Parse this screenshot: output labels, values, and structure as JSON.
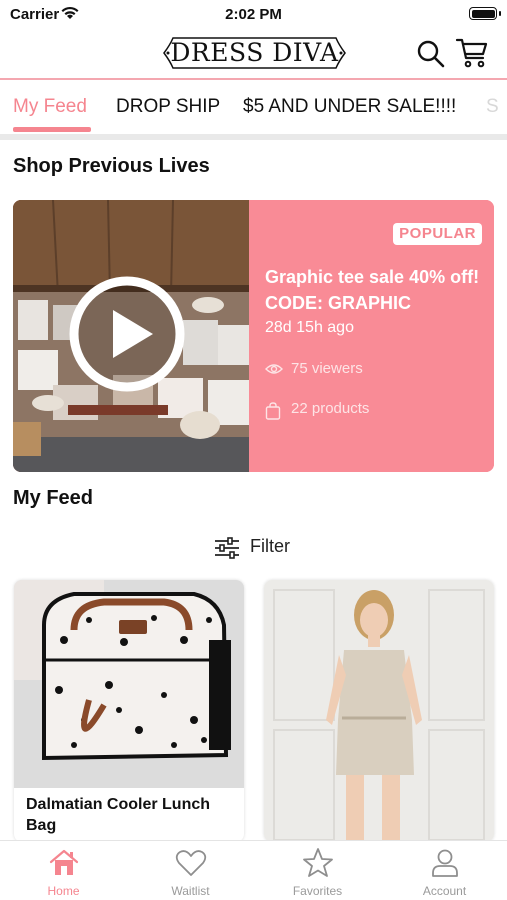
{
  "status_bar": {
    "carrier": "Carrier",
    "time": "2:02 PM"
  },
  "header": {
    "brand": "DRESS DIVA"
  },
  "tabs": [
    {
      "label": "My Feed",
      "active": true
    },
    {
      "label": "DROP SHIP",
      "active": false
    },
    {
      "label": "$5 AND UNDER SALE!!!!",
      "active": false
    },
    {
      "label": "S",
      "active": false
    }
  ],
  "previous_lives": {
    "title": "Shop Previous Lives",
    "card": {
      "badge": "POPULAR",
      "title": "Graphic tee sale 40% off! CODE: GRAPHIC",
      "time_ago": "28d 15h ago",
      "viewers": "75 viewers",
      "products": "22 products"
    }
  },
  "feed": {
    "title": "My Feed",
    "filter_label": "Filter",
    "products": [
      {
        "name": "Dalmatian Cooler Lunch Bag"
      },
      {
        "name": ""
      }
    ]
  },
  "tab_bar": [
    {
      "label": "Home",
      "icon": "home-icon",
      "active": true
    },
    {
      "label": "Waitlist",
      "icon": "heart-icon",
      "active": false
    },
    {
      "label": "Favorites",
      "icon": "star-icon",
      "active": false
    },
    {
      "label": "Account",
      "icon": "person-icon",
      "active": false
    }
  ],
  "colors": {
    "accent": "#f5858f",
    "card_pink": "#f98b96",
    "divider": "#f4a7b0"
  }
}
